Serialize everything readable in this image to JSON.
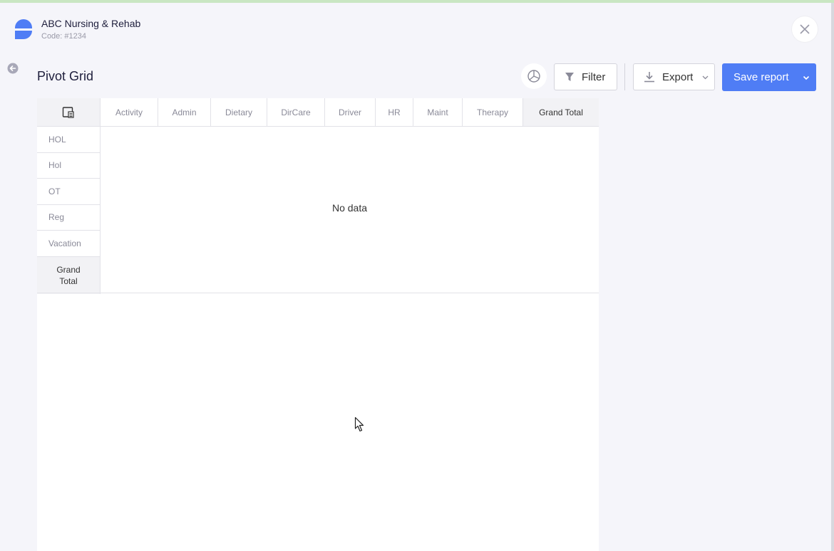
{
  "header": {
    "org_name": "ABC Nursing & Rehab",
    "org_code": "Code: #1234"
  },
  "page": {
    "title": "Pivot Grid"
  },
  "toolbar": {
    "filter_label": "Filter",
    "export_label": "Export",
    "save_label": "Save report"
  },
  "pivot": {
    "columns": [
      "Activity",
      "Admin",
      "Dietary",
      "DirCare",
      "Driver",
      "HR",
      "Maint",
      "Therapy"
    ],
    "column_total": "Grand Total",
    "rows": [
      "HOL",
      "Hol",
      "OT",
      "Reg",
      "Vacation"
    ],
    "row_total": "Grand Total",
    "empty_message": "No data"
  },
  "colors": {
    "accent": "#4f7df5",
    "logo": "#4f7df5"
  },
  "icons": {
    "logo": "org-logo-icon",
    "close": "close-icon",
    "back": "back-arrow-icon",
    "chart": "pie-chart-icon",
    "filter": "filter-icon",
    "export": "download-icon",
    "caret": "chevron-down-icon",
    "fields": "field-chooser-icon"
  }
}
